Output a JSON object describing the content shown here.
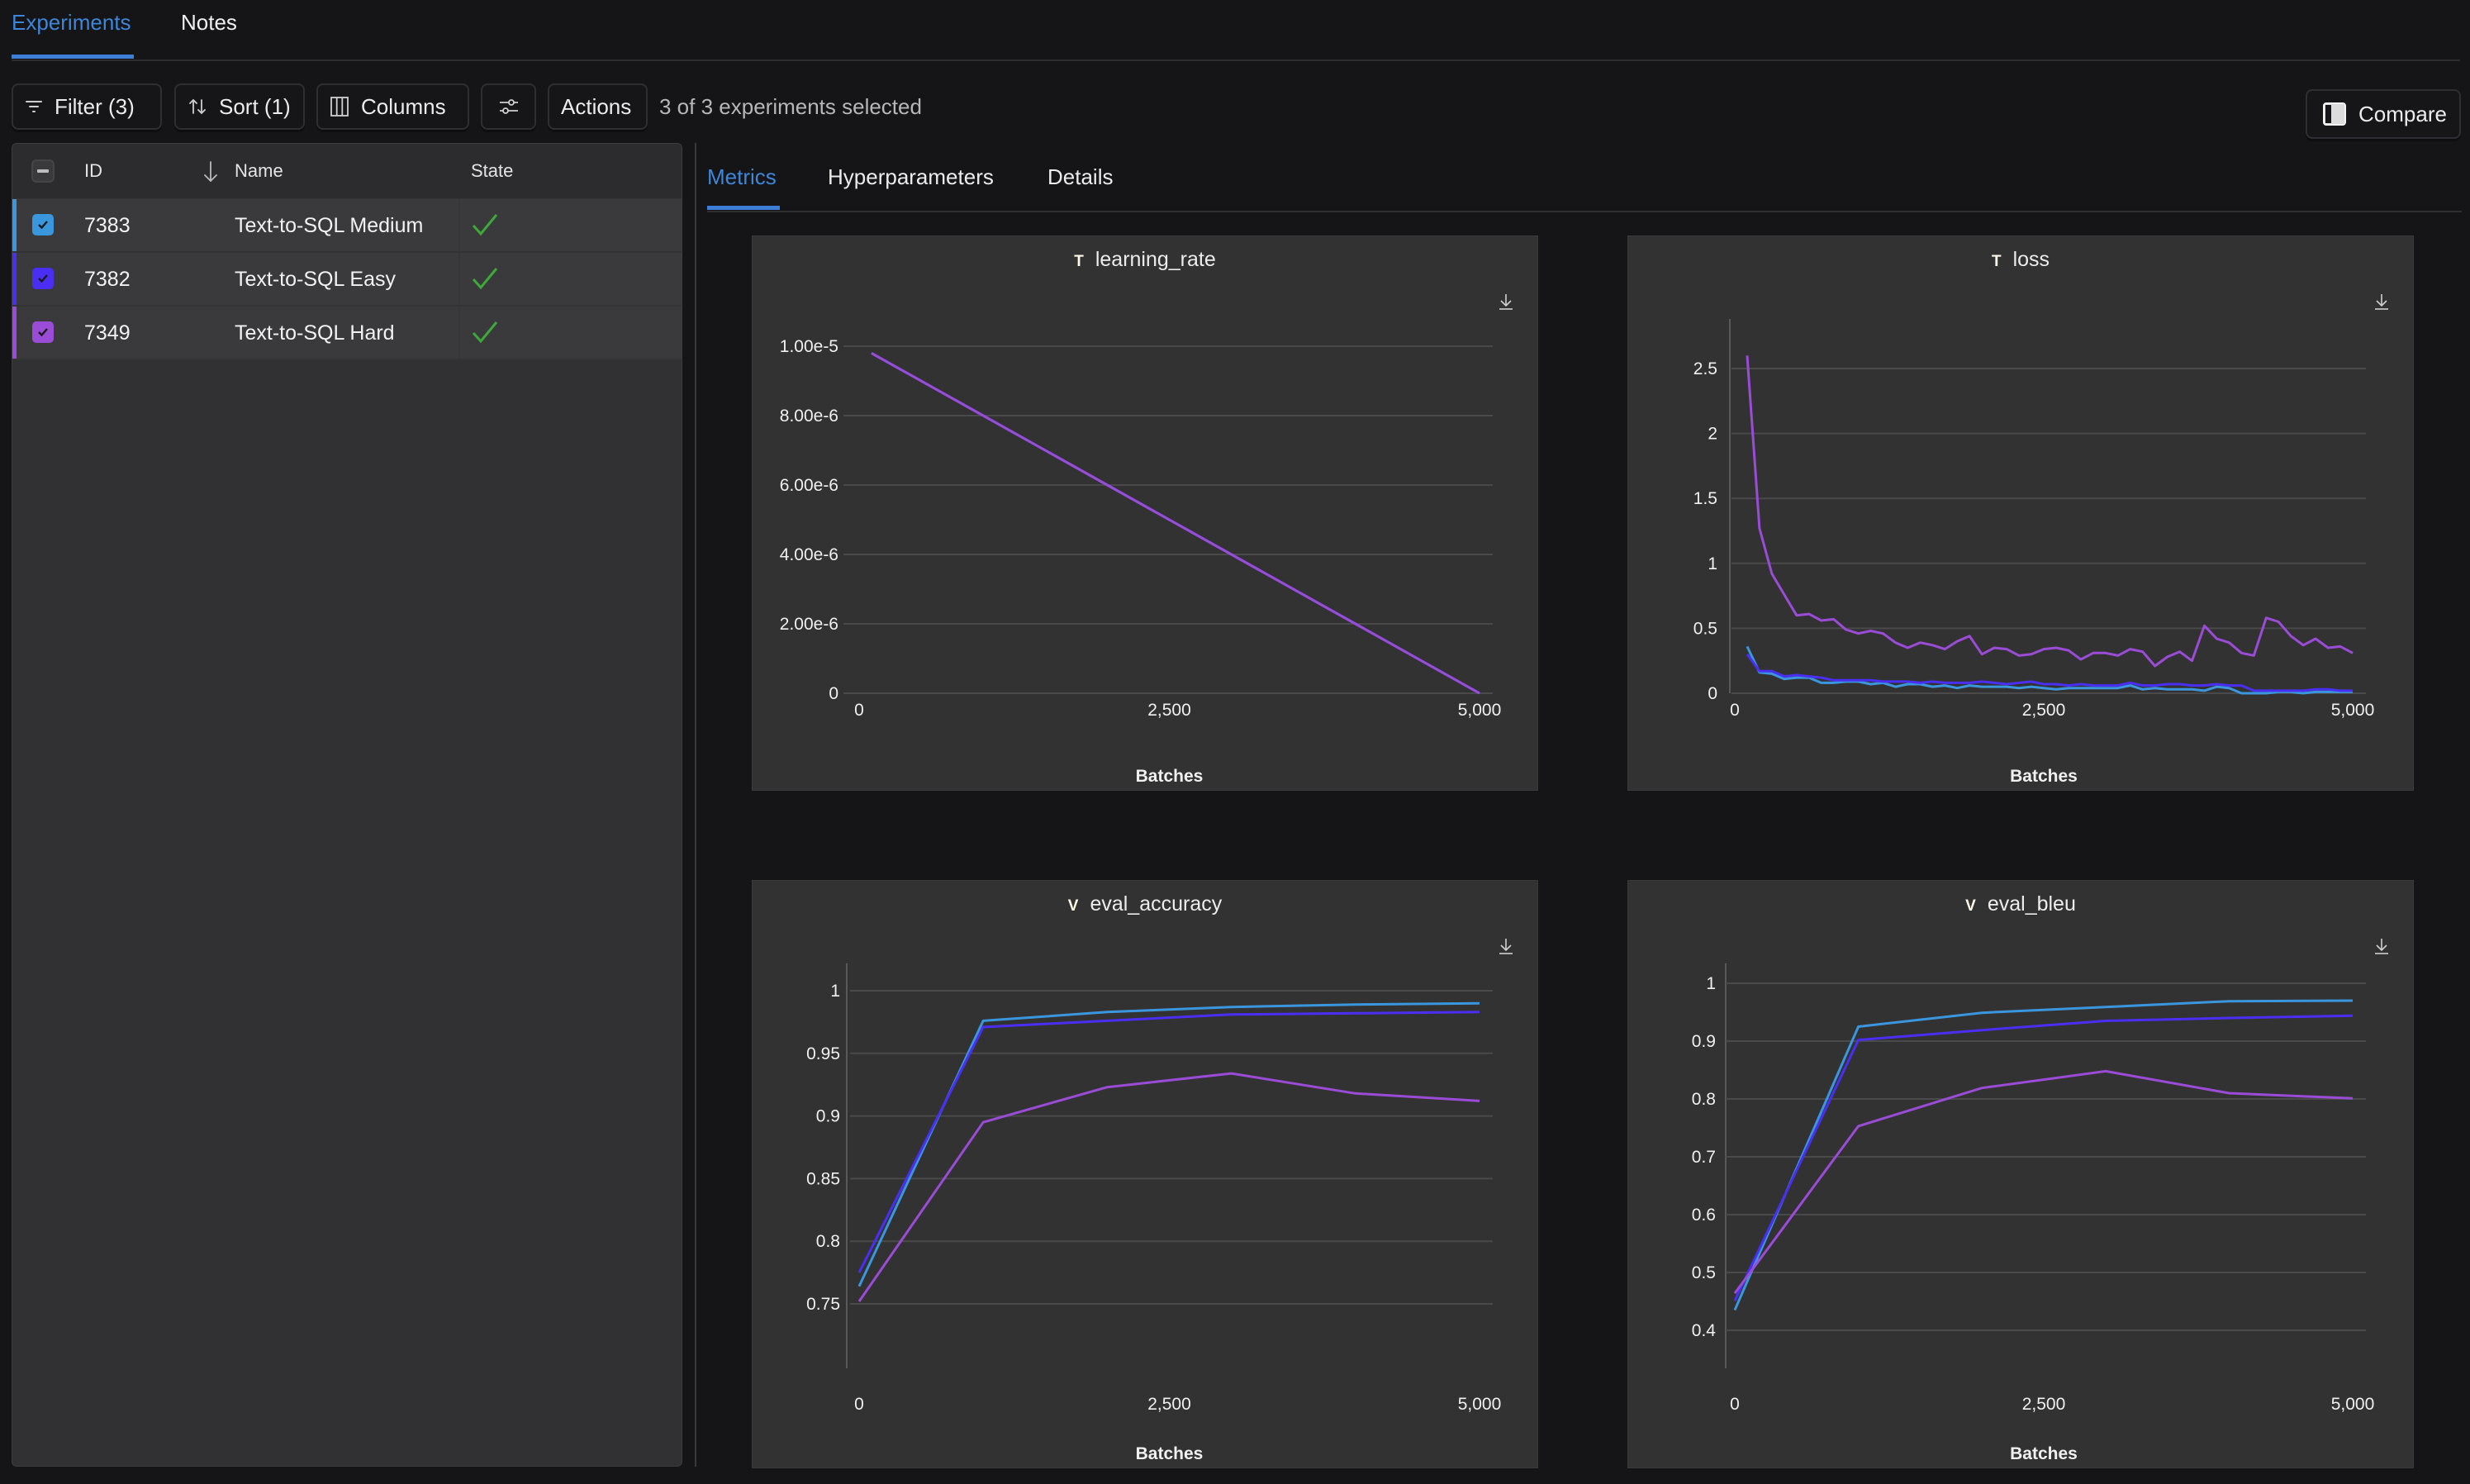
{
  "top_tabs": [
    {
      "label": "Experiments",
      "active": true
    },
    {
      "label": "Notes",
      "active": false
    }
  ],
  "toolbar": {
    "filter_label": "Filter (3)",
    "sort_label": "Sort (1)",
    "columns_label": "Columns",
    "settings_icon": "sliders-icon",
    "actions_label": "Actions",
    "selection_text": "3 of 3 experiments selected",
    "compare_label": "Compare"
  },
  "table": {
    "headers": {
      "id": "ID",
      "name": "Name",
      "state": "State"
    },
    "sort_icon": "arrow-down-icon",
    "rows": [
      {
        "id": "7383",
        "name": "Text-to-SQL Medium",
        "state": "completed",
        "color": "#3a97dd",
        "checked": true
      },
      {
        "id": "7382",
        "name": "Text-to-SQL Easy",
        "state": "completed",
        "color": "#4a2ff2",
        "checked": true
      },
      {
        "id": "7349",
        "name": "Text-to-SQL Hard",
        "state": "completed",
        "color": "#9a4cd6",
        "checked": true
      }
    ],
    "state_color": "#3fa83a"
  },
  "detail_tabs": [
    {
      "label": "Metrics",
      "active": true
    },
    {
      "label": "Hyperparameters",
      "active": false
    },
    {
      "label": "Details",
      "active": false
    }
  ],
  "colors": {
    "accent": "#3d86d8",
    "medium": "#3a97dd",
    "easy": "#4a2ff2",
    "hard": "#9a4cd6"
  },
  "chart_data": [
    {
      "type": "line",
      "badge": "T",
      "title": "learning_rate",
      "xlabel": "Batches",
      "ylabel": "",
      "xlim": [
        0,
        5000
      ],
      "ylim": [
        0,
        1e-05
      ],
      "xticks": [
        0,
        2500,
        5000
      ],
      "xtick_labels": [
        "0",
        "2,500",
        "5,000"
      ],
      "yticks": [
        0,
        2e-06,
        4e-06,
        6e-06,
        8e-06,
        1e-05
      ],
      "ytick_labels": [
        "0",
        "2.00e-6",
        "4.00e-6",
        "6.00e-6",
        "8.00e-6",
        "1.00e-5"
      ],
      "grid": true,
      "series": [
        {
          "name": "Text-to-SQL Medium",
          "color": "#3a97dd",
          "x": [
            100,
            5000
          ],
          "values": [
            9.8e-06,
            0
          ]
        },
        {
          "name": "Text-to-SQL Easy",
          "color": "#4a2ff2",
          "x": [
            100,
            5000
          ],
          "values": [
            9.8e-06,
            0
          ]
        },
        {
          "name": "Text-to-SQL Hard",
          "color": "#9a4cd6",
          "x": [
            100,
            5000
          ],
          "values": [
            9.8e-06,
            0
          ]
        }
      ]
    },
    {
      "type": "line",
      "badge": "T",
      "title": "loss",
      "xlabel": "Batches",
      "ylabel": "",
      "xlim": [
        0,
        5000
      ],
      "ylim": [
        0,
        2.9
      ],
      "xticks": [
        0,
        2500,
        5000
      ],
      "xtick_labels": [
        "0",
        "2,500",
        "5,000"
      ],
      "yticks": [
        0,
        0.5,
        1,
        1.5,
        2,
        2.5
      ],
      "ytick_labels": [
        "0",
        "0.5",
        "1",
        "1.5",
        "2",
        "2.5"
      ],
      "grid": true,
      "series": [
        {
          "name": "Text-to-SQL Medium",
          "color": "#3a97dd",
          "x": [
            100,
            200,
            300,
            400,
            500,
            600,
            700,
            800,
            900,
            1000,
            1100,
            1200,
            1300,
            1400,
            1500,
            1600,
            1700,
            1800,
            1900,
            2000,
            2100,
            2200,
            2300,
            2400,
            2500,
            2600,
            2700,
            2800,
            2900,
            3000,
            3100,
            3200,
            3300,
            3400,
            3500,
            3600,
            3700,
            3800,
            3900,
            4000,
            4100,
            4200,
            4300,
            4400,
            4500,
            4600,
            4700,
            4800,
            4900,
            5000
          ],
          "values": [
            0.36,
            0.16,
            0.15,
            0.11,
            0.12,
            0.12,
            0.08,
            0.08,
            0.09,
            0.09,
            0.07,
            0.08,
            0.05,
            0.07,
            0.07,
            0.05,
            0.06,
            0.04,
            0.06,
            0.05,
            0.05,
            0.05,
            0.04,
            0.05,
            0.04,
            0.03,
            0.04,
            0.04,
            0.04,
            0.04,
            0.04,
            0.06,
            0.03,
            0.04,
            0.03,
            0.03,
            0.03,
            0.02,
            0.05,
            0.04,
            0.0,
            0.0,
            0.0,
            0.01,
            0.01,
            0.0,
            0.01,
            0.01,
            0.01,
            0.01
          ]
        },
        {
          "name": "Text-to-SQL Easy",
          "color": "#4a2ff2",
          "x": [
            100,
            200,
            300,
            400,
            500,
            600,
            700,
            800,
            900,
            1000,
            1100,
            1200,
            1300,
            1400,
            1500,
            1600,
            1700,
            1800,
            1900,
            2000,
            2100,
            2200,
            2300,
            2400,
            2500,
            2600,
            2700,
            2800,
            2900,
            3000,
            3100,
            3200,
            3300,
            3400,
            3500,
            3600,
            3700,
            3800,
            3900,
            4000,
            4100,
            4200,
            4300,
            4400,
            4500,
            4600,
            4700,
            4800,
            4900,
            5000
          ],
          "values": [
            0.3,
            0.17,
            0.17,
            0.13,
            0.14,
            0.13,
            0.12,
            0.1,
            0.1,
            0.1,
            0.1,
            0.09,
            0.09,
            0.09,
            0.08,
            0.09,
            0.08,
            0.08,
            0.08,
            0.09,
            0.08,
            0.07,
            0.08,
            0.09,
            0.07,
            0.07,
            0.06,
            0.07,
            0.06,
            0.06,
            0.06,
            0.08,
            0.06,
            0.06,
            0.07,
            0.07,
            0.06,
            0.06,
            0.07,
            0.06,
            0.06,
            0.02,
            0.02,
            0.02,
            0.02,
            0.02,
            0.03,
            0.03,
            0.02,
            0.02
          ]
        },
        {
          "name": "Text-to-SQL Hard",
          "color": "#9a4cd6",
          "x": [
            100,
            200,
            300,
            400,
            500,
            600,
            700,
            800,
            900,
            1000,
            1100,
            1200,
            1300,
            1400,
            1500,
            1600,
            1700,
            1800,
            1900,
            2000,
            2100,
            2200,
            2300,
            2400,
            2500,
            2600,
            2700,
            2800,
            2900,
            3000,
            3100,
            3200,
            3300,
            3400,
            3500,
            3600,
            3700,
            3800,
            3900,
            4000,
            4100,
            4200,
            4300,
            4400,
            4500,
            4600,
            4700,
            4800,
            4900,
            5000
          ],
          "values": [
            2.6,
            1.27,
            0.92,
            0.76,
            0.6,
            0.61,
            0.56,
            0.57,
            0.49,
            0.46,
            0.48,
            0.46,
            0.39,
            0.35,
            0.39,
            0.37,
            0.34,
            0.4,
            0.44,
            0.3,
            0.35,
            0.34,
            0.29,
            0.3,
            0.34,
            0.35,
            0.33,
            0.26,
            0.31,
            0.31,
            0.29,
            0.34,
            0.32,
            0.21,
            0.28,
            0.32,
            0.25,
            0.52,
            0.42,
            0.39,
            0.31,
            0.29,
            0.58,
            0.55,
            0.44,
            0.37,
            0.42,
            0.35,
            0.36,
            0.31
          ]
        }
      ]
    },
    {
      "type": "line",
      "badge": "V",
      "title": "eval_accuracy",
      "xlabel": "Batches",
      "ylabel": "",
      "xlim": [
        0,
        5000
      ],
      "ylim": [
        0.72,
        1.02
      ],
      "xticks": [
        0,
        2500,
        5000
      ],
      "xtick_labels": [
        "0",
        "2,500",
        "5,000"
      ],
      "yticks": [
        0.75,
        0.8,
        0.85,
        0.9,
        0.95,
        1
      ],
      "ytick_labels": [
        "0.75",
        "0.8",
        "0.85",
        "0.9",
        "0.95",
        "1"
      ],
      "grid": true,
      "series": [
        {
          "name": "Text-to-SQL Medium",
          "color": "#3a97dd",
          "x": [
            0,
            1000,
            2000,
            3000,
            4000,
            5000
          ],
          "values": [
            0.764,
            0.976,
            0.983,
            0.987,
            0.989,
            0.99
          ]
        },
        {
          "name": "Text-to-SQL Easy",
          "color": "#4a2ff2",
          "x": [
            0,
            1000,
            2000,
            3000,
            4000,
            5000
          ],
          "values": [
            0.775,
            0.971,
            0.976,
            0.981,
            0.982,
            0.983
          ]
        },
        {
          "name": "Text-to-SQL Hard",
          "color": "#9a4cd6",
          "x": [
            0,
            1000,
            2000,
            3000,
            4000,
            5000
          ],
          "values": [
            0.752,
            0.895,
            0.923,
            0.934,
            0.918,
            0.912
          ]
        }
      ]
    },
    {
      "type": "line",
      "badge": "V",
      "title": "eval_bleu",
      "xlabel": "Batches",
      "ylabel": "",
      "xlim": [
        0,
        5000
      ],
      "ylim": [
        0.38,
        1.03
      ],
      "xticks": [
        0,
        2500,
        5000
      ],
      "xtick_labels": [
        "0",
        "2,500",
        "5,000"
      ],
      "yticks": [
        0.4,
        0.5,
        0.6,
        0.7,
        0.8,
        0.9,
        1
      ],
      "ytick_labels": [
        "0.4",
        "0.5",
        "0.6",
        "0.7",
        "0.8",
        "0.9",
        "1"
      ],
      "grid": true,
      "series": [
        {
          "name": "Text-to-SQL Medium",
          "color": "#3a97dd",
          "x": [
            0,
            1000,
            2000,
            3000,
            4000,
            5000
          ],
          "values": [
            0.435,
            0.925,
            0.949,
            0.959,
            0.969,
            0.97
          ]
        },
        {
          "name": "Text-to-SQL Easy",
          "color": "#4a2ff2",
          "x": [
            0,
            1000,
            2000,
            3000,
            4000,
            5000
          ],
          "values": [
            0.451,
            0.902,
            0.919,
            0.935,
            0.94,
            0.944
          ]
        },
        {
          "name": "Text-to-SQL Hard",
          "color": "#9a4cd6",
          "x": [
            0,
            1000,
            2000,
            3000,
            4000,
            5000
          ],
          "values": [
            0.464,
            0.753,
            0.819,
            0.848,
            0.81,
            0.801
          ]
        }
      ]
    }
  ]
}
